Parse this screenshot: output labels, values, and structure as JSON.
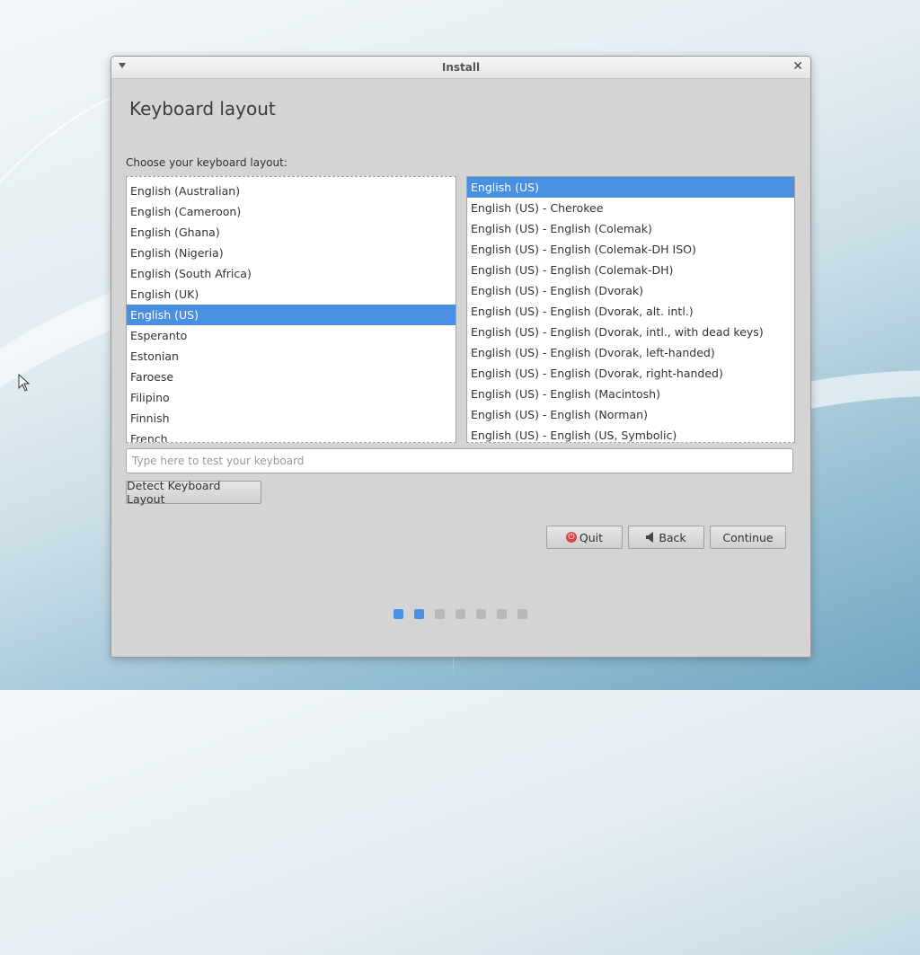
{
  "window": {
    "title": "Install"
  },
  "page": {
    "heading": "Keyboard layout",
    "prompt": "Choose your keyboard layout:"
  },
  "layouts": [
    "English (Australian)",
    "English (Cameroon)",
    "English (Ghana)",
    "English (Nigeria)",
    "English (South Africa)",
    "English (UK)",
    "English (US)",
    "Esperanto",
    "Estonian",
    "Faroese",
    "Filipino",
    "Finnish",
    "French"
  ],
  "layouts_selected_index": 6,
  "variants": [
    "English (US)",
    "English (US) - Cherokee",
    "English (US) - English (Colemak)",
    "English (US) - English (Colemak-DH ISO)",
    "English (US) - English (Colemak-DH)",
    "English (US) - English (Dvorak)",
    "English (US) - English (Dvorak, alt. intl.)",
    "English (US) - English (Dvorak, intl., with dead keys)",
    "English (US) - English (Dvorak, left-handed)",
    "English (US) - English (Dvorak, right-handed)",
    "English (US) - English (Macintosh)",
    "English (US) - English (Norman)",
    "English (US) - English (US, Symbolic)"
  ],
  "variants_selected_index": 0,
  "test_field": {
    "placeholder": "Type here to test your keyboard",
    "value": ""
  },
  "buttons": {
    "detect": "Detect Keyboard Layout",
    "quit": "Quit",
    "back": "Back",
    "continue": "Continue"
  },
  "progress": {
    "total_steps": 7,
    "completed_steps": 2
  },
  "colors": {
    "accent": "#4a90e2",
    "quit_icon": "#d64545"
  }
}
